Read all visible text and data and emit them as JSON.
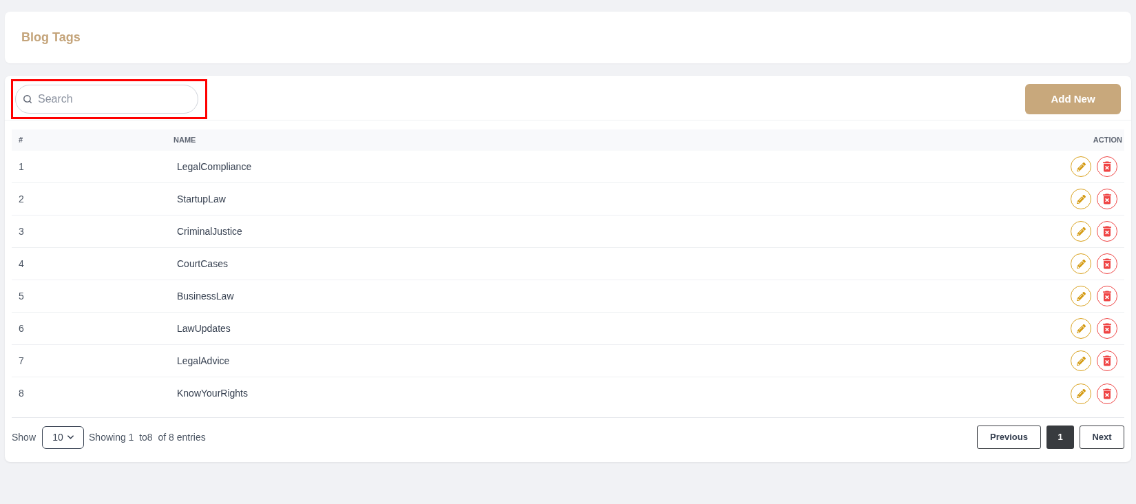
{
  "header": {
    "title": "Blog Tags"
  },
  "toolbar": {
    "search": {
      "placeholder": "Search",
      "highlighted": true
    },
    "add_button": "Add New"
  },
  "table": {
    "columns": [
      "#",
      "NAME",
      "ACTION"
    ],
    "rows": [
      {
        "number": "1",
        "name": "LegalCompliance"
      },
      {
        "number": "2",
        "name": "StartupLaw"
      },
      {
        "number": "3",
        "name": "CriminalJustice"
      },
      {
        "number": "4",
        "name": "CourtCases"
      },
      {
        "number": "5",
        "name": "BusinessLaw"
      },
      {
        "number": "6",
        "name": "LawUpdates"
      },
      {
        "number": "7",
        "name": "LegalAdvice"
      },
      {
        "number": "8",
        "name": "KnowYourRights"
      }
    ]
  },
  "footer": {
    "show_label": "Show",
    "page_size": "10",
    "summary": "Showing 1  to8  of 8 entries",
    "pagination": {
      "previous": "Previous",
      "pages": [
        {
          "label": "1",
          "selected": true
        }
      ],
      "next": "Next"
    }
  }
}
